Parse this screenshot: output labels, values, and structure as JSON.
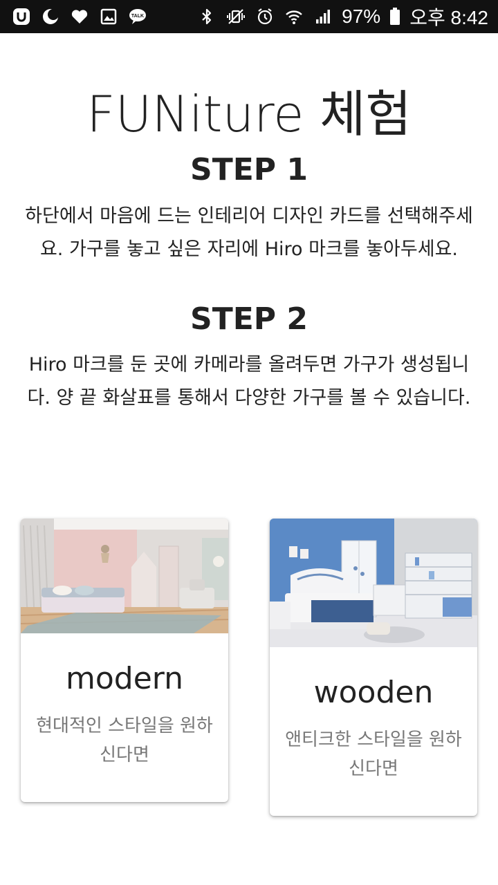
{
  "status_bar": {
    "left_icons": [
      "u-plus-icon",
      "moon-icon",
      "heart-icon",
      "gallery-icon",
      "kakaotalk-icon"
    ],
    "right_icons": [
      "bluetooth-icon",
      "vibrate-icon",
      "alarm-icon",
      "wifi-icon",
      "signal-icon"
    ],
    "battery_text": "97%",
    "time": "오후 8:42",
    "kakao_label": "TALK"
  },
  "header": {
    "title": "FUNiture 체험"
  },
  "steps": [
    {
      "heading": "STEP 1",
      "text": "하단에서 마음에 드는 인테리어 디자인 카드를 선택해주세요. 가구를 놓고 싶은 자리에 Hiro 마크를 놓아두세요."
    },
    {
      "heading": "STEP 2",
      "text": "Hiro 마크를 둔 곳에 카메라를 올려두면 가구가 생성됩니다. 양 끝 화살표를 통해서 다양한 가구를 볼 수 있습니다."
    }
  ],
  "cards": [
    {
      "title": "modern",
      "description": "현대적인 스타일을 원하신다면",
      "image": "pastel-pink-bedroom-photo"
    },
    {
      "title": "wooden",
      "description": "앤티크한 스타일을 원하신다면",
      "image": "blue-white-kids-bedroom-photo"
    }
  ],
  "colors": {
    "status_bar_bg": "#111111",
    "text_primary": "#222222",
    "text_secondary": "#777777",
    "background": "#ffffff"
  }
}
